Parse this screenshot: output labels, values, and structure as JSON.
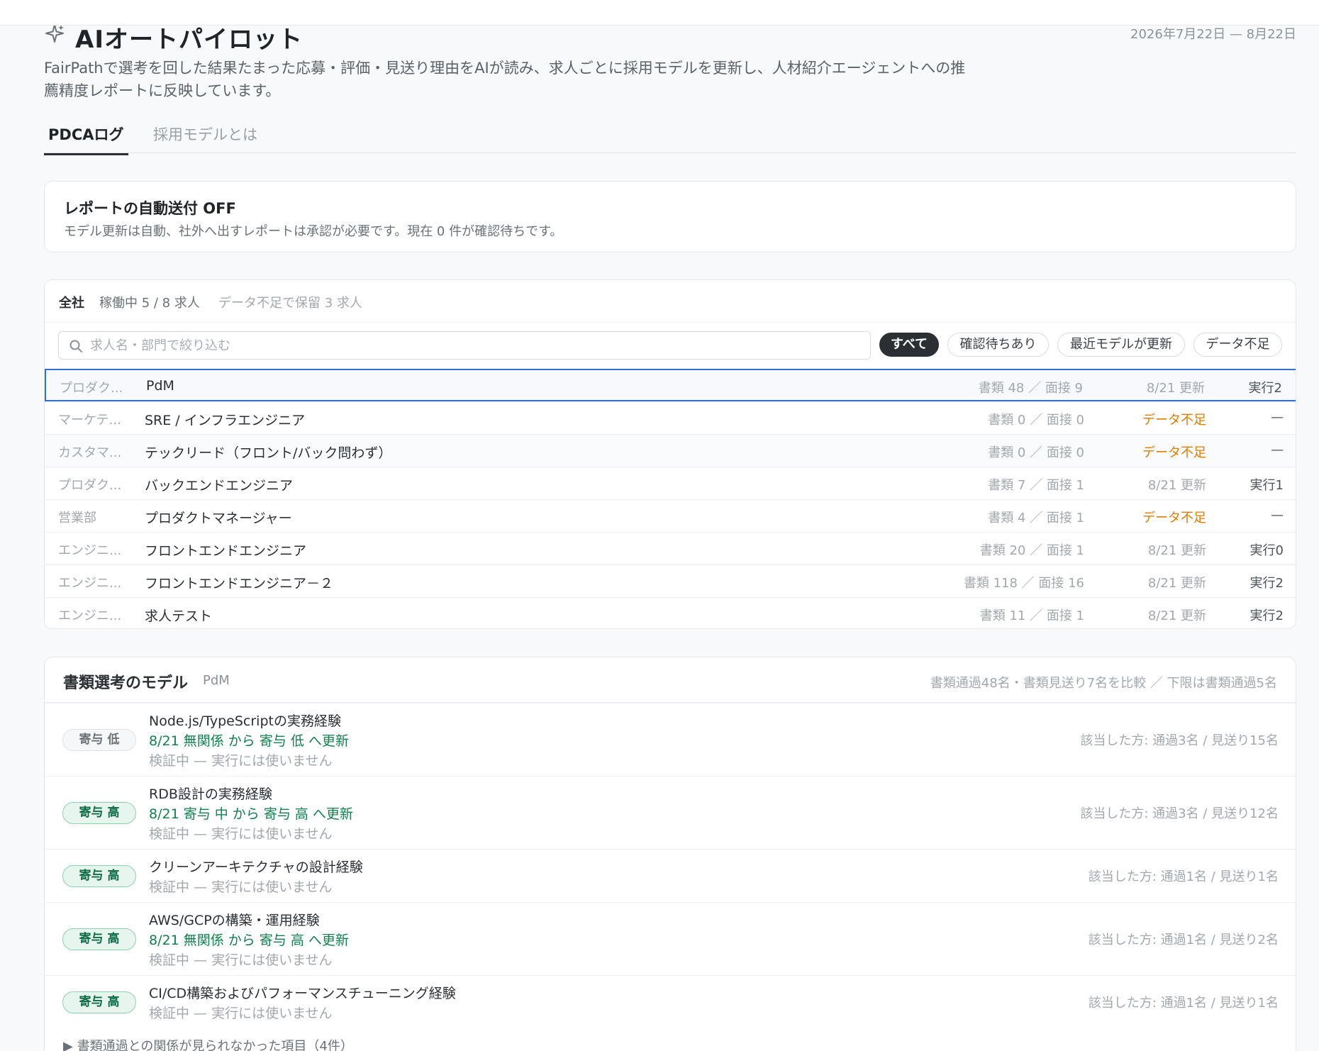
{
  "header": {
    "title": "AIオートパイロット",
    "date_range": "2026年7月22日 — 8月22日",
    "description": "FairPathで選考を回した結果たまった応募・評価・見送り理由をAIが読み、求人ごとに採用モデルを更新し、人材紹介エージェントへの推薦精度レポートに反映しています。"
  },
  "tabs": [
    {
      "label": "PDCAログ",
      "active": true
    },
    {
      "label": "採用モデルとは",
      "active": false
    }
  ],
  "notice": {
    "title": "レポートの自動送付 OFF",
    "subtitle": "モデル更新は自動、社外へ出すレポートは承認が必要です。現在 0 件が確認待ちです。"
  },
  "jobs": {
    "scope": "全社",
    "active": "稼働中 5 / 8 求人",
    "hold": "データ不足で保留 3 求人",
    "search_placeholder": "求人名・部門で絞り込む",
    "filters": [
      "すべて",
      "確認待ちあり",
      "最近モデルが更新",
      "データ不足"
    ],
    "rows": [
      {
        "dept": "プロダク...",
        "name": "PdM",
        "counts": "書類 48 ／ 面接 9",
        "update": "8/21 更新",
        "exec": "実行2"
      },
      {
        "dept": "マーケテ...",
        "name": "SRE / インフラエンジニア",
        "counts": "書類 0 ／ 面接 0",
        "update": "データ不足",
        "exec": "—"
      },
      {
        "dept": "カスタマ...",
        "name": "テックリード（フロント/バック問わず）",
        "counts": "書類 0 ／ 面接 0",
        "update": "データ不足",
        "exec": "—"
      },
      {
        "dept": "プロダク...",
        "name": "バックエンドエンジニア",
        "counts": "書類 7 ／ 面接 1",
        "update": "8/21 更新",
        "exec": "実行1"
      },
      {
        "dept": "営業部",
        "name": "プロダクトマネージャー",
        "counts": "書類 4 ／ 面接 1",
        "update": "データ不足",
        "exec": "—"
      },
      {
        "dept": "エンジニ...",
        "name": "フロントエンドエンジニア",
        "counts": "書類 20 ／ 面接 1",
        "update": "8/21 更新",
        "exec": "実行0"
      },
      {
        "dept": "エンジニ...",
        "name": "フロントエンドエンジニア－２",
        "counts": "書類 118 ／ 面接 16",
        "update": "8/21 更新",
        "exec": "実行2"
      },
      {
        "dept": "エンジニ...",
        "name": "求人テスト",
        "counts": "書類 11 ／ 面接 1",
        "update": "8/21 更新",
        "exec": "実行2"
      }
    ]
  },
  "model": {
    "title": "書類選考のモデル",
    "job": "PdM",
    "note": "書類通過48名・書類見送り7名を比較 ／ 下限は書類通過5名",
    "factors": [
      {
        "badge": "寄与 低",
        "level": "low",
        "name": "Node.js/TypeScriptの実務経験",
        "change": "8/21 無関係 から 寄与 低 へ更新",
        "status": "検証中 — 実行には使いません",
        "counts": "該当した方: 通過3名 / 見送り15名"
      },
      {
        "badge": "寄与 高",
        "level": "high",
        "name": "RDB設計の実務経験",
        "change": "8/21 寄与 中 から 寄与 高 へ更新",
        "status": "検証中 — 実行には使いません",
        "counts": "該当した方: 通過3名 / 見送り12名"
      },
      {
        "badge": "寄与 高",
        "level": "high",
        "name": "クリーンアーキテクチャの設計経験",
        "change": "",
        "status": "検証中 — 実行には使いません",
        "counts": "該当した方: 通過1名 / 見送り1名"
      },
      {
        "badge": "寄与 高",
        "level": "high",
        "name": "AWS/GCPの構築・運用経験",
        "change": "8/21 無関係 から 寄与 高 へ更新",
        "status": "検証中 — 実行には使いません",
        "counts": "該当した方: 通過1名 / 見送り2名"
      },
      {
        "badge": "寄与 高",
        "level": "high",
        "name": "CI/CD構築およびパフォーマンスチューニング経験",
        "change": "",
        "status": "検証中 — 実行には使いません",
        "counts": "該当した方: 通過1名 / 見送り1名"
      }
    ],
    "collapsed": "▶ 書類通過との関係が見られなかった項目（4件）"
  }
}
